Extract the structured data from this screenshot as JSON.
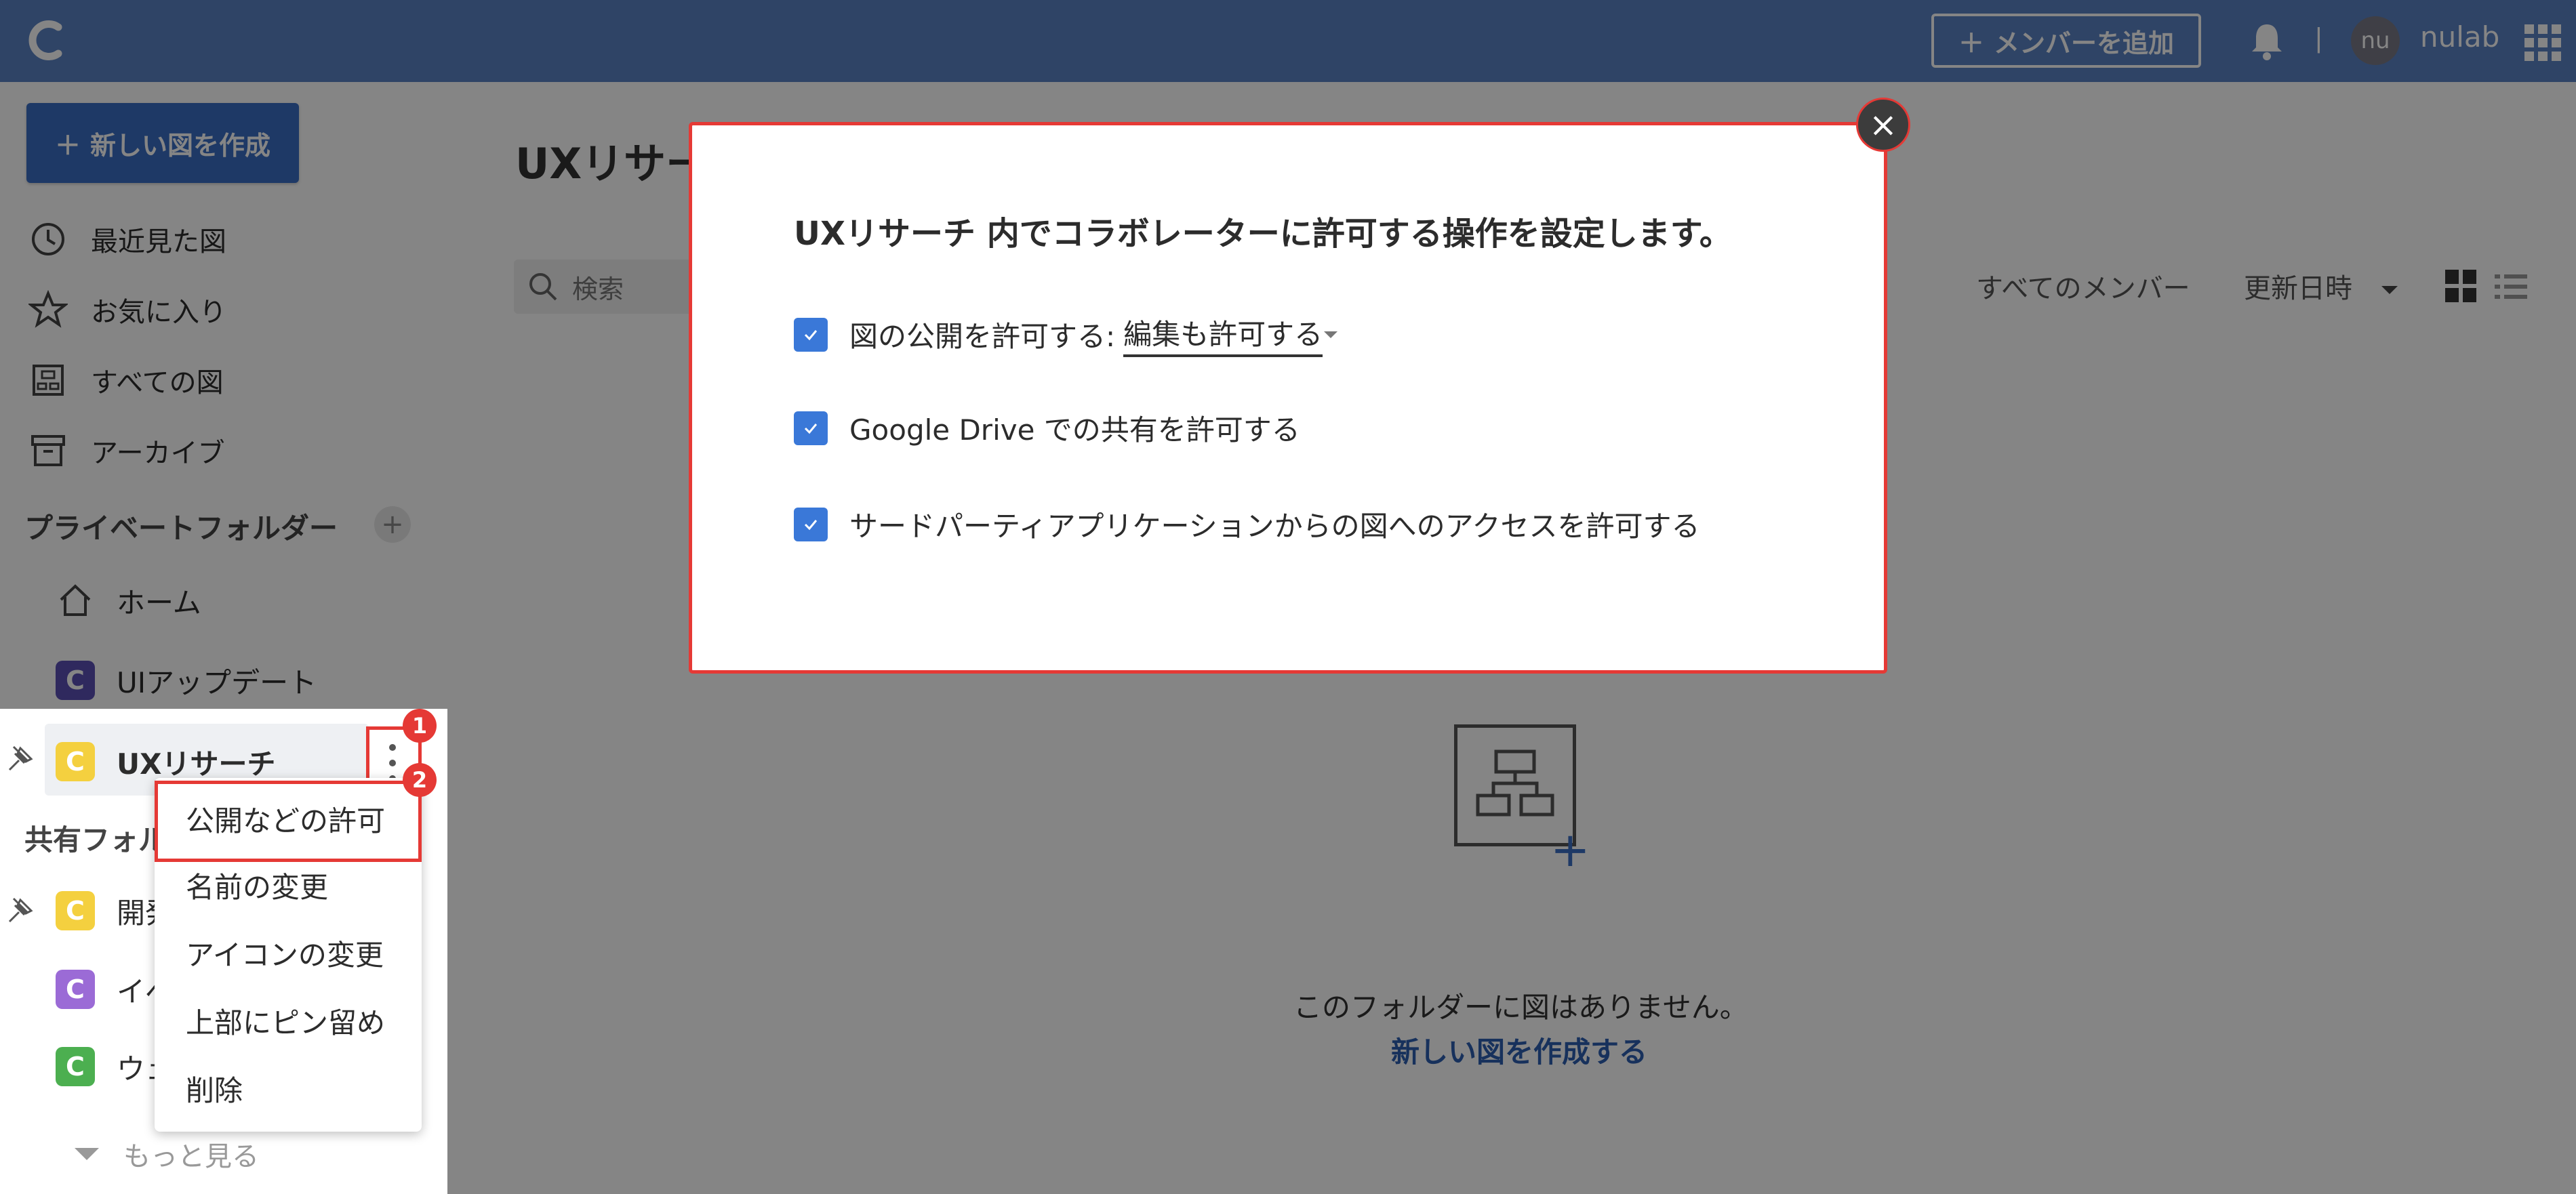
{
  "topbar": {
    "add_member_label": "メンバーを追加",
    "username": "nulab",
    "avatar_initials": "nu"
  },
  "sidebar": {
    "new_diagram_label": "新しい図を作成",
    "nav": [
      {
        "label": "最近見た図",
        "icon": "history-icon"
      },
      {
        "label": "お気に入り",
        "icon": "star-icon"
      },
      {
        "label": "すべての図",
        "icon": "diagram-icon"
      },
      {
        "label": "アーカイブ",
        "icon": "archive-icon"
      }
    ],
    "private_section_title": "プライベートフォルダー",
    "private_folders": [
      {
        "label": "ホーム",
        "icon": "home-icon"
      },
      {
        "label": "UIアップデート",
        "color": "#5a4fb5"
      },
      {
        "label": "UXリサーチ",
        "color": "#f4d03f"
      }
    ],
    "shared_section_title": "共有フォルダー",
    "shared_folders": [
      {
        "label": "開発",
        "color": "#f4d03f"
      },
      {
        "label": "イベント",
        "color": "#9b6bd6"
      },
      {
        "label": "ウェブ",
        "color": "#4caf50"
      }
    ],
    "more_label": "もっと見る"
  },
  "main": {
    "heading": "UXリサーチ",
    "search_placeholder": "検索",
    "member_filter": "すべてのメンバー",
    "sort_label": "更新日時",
    "empty_text": "このフォルダーに図はありません。",
    "empty_link": "新しい図を作成する"
  },
  "modal": {
    "title": "UXリサーチ 内でコラボレーターに許可する操作を設定します。",
    "option1_label": "図の公開を許可する:",
    "option1_select": "編集も許可する",
    "option2_label": "Google Drive での共有を許可する",
    "option3_label": "サードパーティアプリケーションからの図へのアクセスを許可する"
  },
  "context_menu": {
    "items": [
      "公開などの許可",
      "名前の変更",
      "アイコンの変更",
      "上部にピン留め",
      "削除"
    ]
  },
  "badges": {
    "step1": "1",
    "step2": "2"
  },
  "colors": {
    "topbar": "#5a82c3",
    "primary": "#3a6dc3",
    "highlight": "#e53935"
  }
}
